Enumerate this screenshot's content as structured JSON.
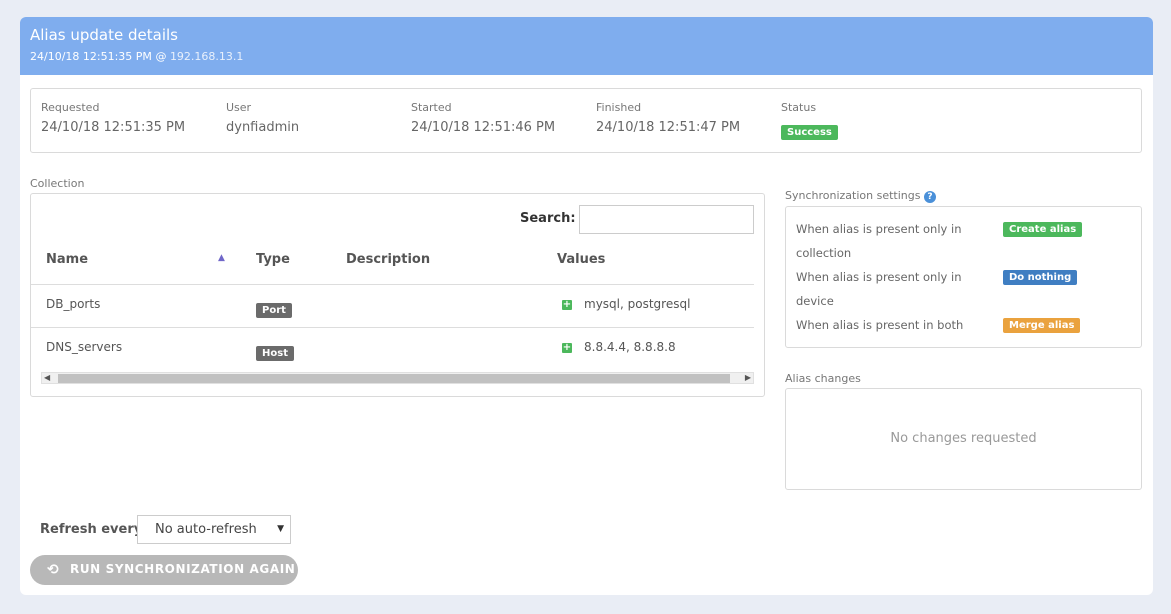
{
  "header": {
    "title": "Alias update details",
    "timestamp": "24/10/18 12:51:35 PM",
    "at": "@",
    "ip": "192.168.13.1"
  },
  "summary": {
    "requested": {
      "label": "Requested",
      "value": "24/10/18 12:51:35 PM"
    },
    "user": {
      "label": "User",
      "value": "dynfiadmin"
    },
    "started": {
      "label": "Started",
      "value": "24/10/18 12:51:46 PM"
    },
    "finished": {
      "label": "Finished",
      "value": "24/10/18 12:51:47 PM"
    },
    "status": {
      "label": "Status",
      "value": "Success"
    }
  },
  "collection": {
    "label": "Collection",
    "search_label": "Search:",
    "search_value": "",
    "columns": [
      "Name",
      "Type",
      "Description",
      "Values"
    ],
    "rows": [
      {
        "name": "DB_ports",
        "type": "Port",
        "description": "",
        "values": "mysql, postgresql"
      },
      {
        "name": "DNS_servers",
        "type": "Host",
        "description": "",
        "values": "8.8.4.4, 8.8.8.8"
      }
    ]
  },
  "sync": {
    "label": "Synchronization settings",
    "rows": [
      {
        "text_1": "When alias is present only in",
        "text_2": "collection",
        "action": "Create alias"
      },
      {
        "text_1": "When alias is present only in",
        "text_2": "device",
        "action": "Do nothing"
      },
      {
        "text_1": "When alias is present in both",
        "action": "Merge alias"
      }
    ]
  },
  "changes": {
    "label": "Alias changes",
    "empty_text": "No changes requested"
  },
  "refresh": {
    "label": "Refresh every",
    "selected": "No auto-refresh"
  },
  "run_button_label": "RUN SYNCHRONIZATION AGAIN",
  "colors": {
    "header_bg": "#7fadee",
    "success": "#4cb85c",
    "do_nothing": "#3f7ec2",
    "merge": "#eaa23e",
    "type_badge": "#6b6b6b",
    "button_disabled": "#b8b8b8"
  }
}
